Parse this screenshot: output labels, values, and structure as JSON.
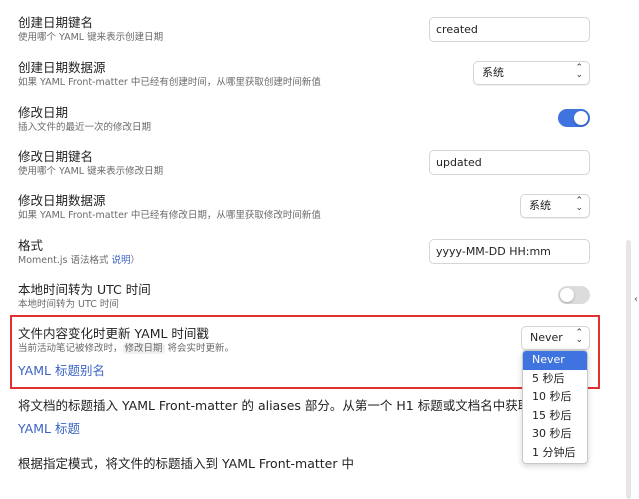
{
  "settings": {
    "created_key": {
      "title": "创建日期键名",
      "desc": "使用哪个 YAML 键来表示创建日期",
      "value": "created"
    },
    "created_source": {
      "title": "创建日期数据源",
      "desc": "如果 YAML Front-matter 中已经有创建时间，从哪里获取创建时间新值",
      "selected": "系统"
    },
    "modified_date": {
      "title": "修改日期",
      "desc": "插入文件的最近一次的修改日期",
      "toggle": "on"
    },
    "modified_key": {
      "title": "修改日期键名",
      "desc": "使用哪个 YAML 键来表示修改日期",
      "value": "updated"
    },
    "modified_source": {
      "title": "修改日期数据源",
      "desc": "如果 YAML Front-matter 中已经有修改日期，从哪里获取修改时间新值",
      "selected": "系统"
    },
    "format": {
      "title": "格式",
      "desc_prefix": "Moment.js 语法格式",
      "desc_link": "说明",
      "desc_suffix": "）",
      "value": "yyyy-MM-DD HH:mm"
    },
    "utc": {
      "title": "本地时间转为 UTC 时间",
      "desc": "本地时间转为 UTC 时间",
      "toggle": "off"
    },
    "update_on_change": {
      "title": "文件内容变化时更新 YAML 时间戳",
      "desc_prefix": "当前活动笔记被修改时，",
      "desc_code": "修改日期",
      "desc_suffix": " 将会实时更新。",
      "selected": "Never"
    }
  },
  "section_alias": {
    "heading": "YAML 标题别名",
    "desc": "将文档的标题插入 YAML Front-matter 的 aliases 部分。从第一个 H1 标题或文档名中获取值"
  },
  "section_title": {
    "heading": "YAML 标题",
    "desc": "根据指定模式，将文件的标题插入到 YAML Front-matter 中"
  },
  "dropdown_options": [
    "Never",
    "5 秒后",
    "10 秒后",
    "15 秒后",
    "30 秒后",
    "1 分钟后"
  ],
  "dropdown_selected_index": 0,
  "icons": {
    "select_chevron": "⌃⌄",
    "edge": "‹"
  },
  "colors": {
    "accent": "#3f73e0",
    "highlight_border": "#e03030",
    "link": "#3b63c4"
  }
}
